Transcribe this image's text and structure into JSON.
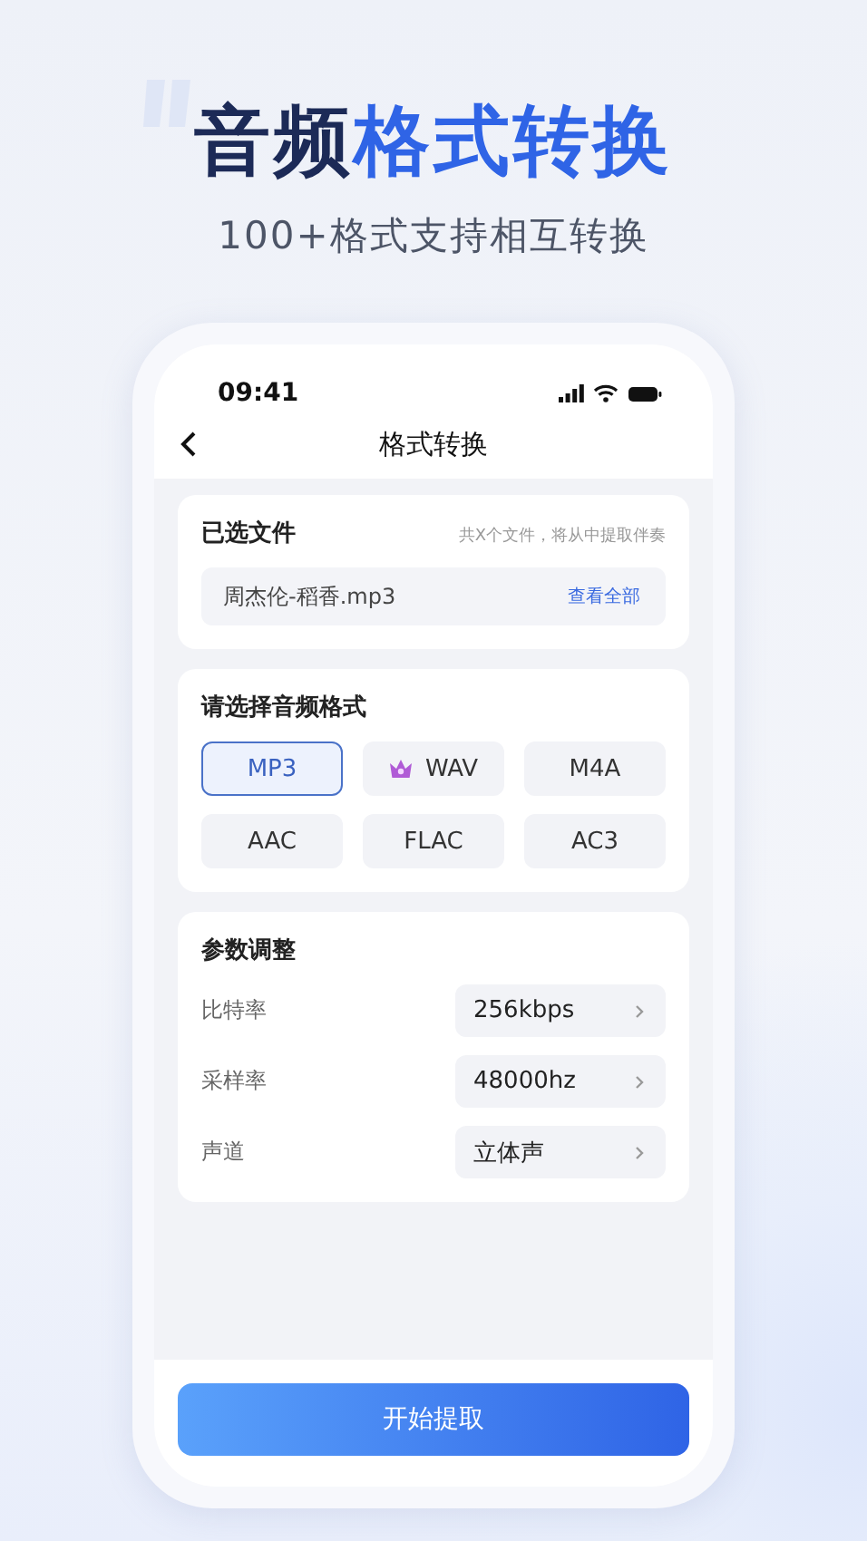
{
  "headline": {
    "part_1": "音频",
    "part_2": "格式转换"
  },
  "tagline": "100+格式支持相互转换",
  "status_bar": {
    "time": "09:41"
  },
  "nav": {
    "title": "格式转换"
  },
  "files_card": {
    "title": "已选文件",
    "hint": "共X个文件，将从中提取伴奏",
    "file_name": "周杰伦-稻香.mp3",
    "link": "查看全部"
  },
  "format_card": {
    "title": "请选择音频格式",
    "formats": [
      {
        "label": "MP3",
        "selected": true,
        "premium": false
      },
      {
        "label": "WAV",
        "selected": false,
        "premium": true
      },
      {
        "label": "M4A",
        "selected": false,
        "premium": false
      },
      {
        "label": "AAC",
        "selected": false,
        "premium": false
      },
      {
        "label": "FLAC",
        "selected": false,
        "premium": false
      },
      {
        "label": "AC3",
        "selected": false,
        "premium": false
      }
    ]
  },
  "params_card": {
    "title": "参数调整",
    "rows": [
      {
        "label": "比特率",
        "value": "256kbps"
      },
      {
        "label": "采样率",
        "value": "48000hz"
      },
      {
        "label": "声道",
        "value": "立体声"
      }
    ]
  },
  "start_button": "开始提取"
}
